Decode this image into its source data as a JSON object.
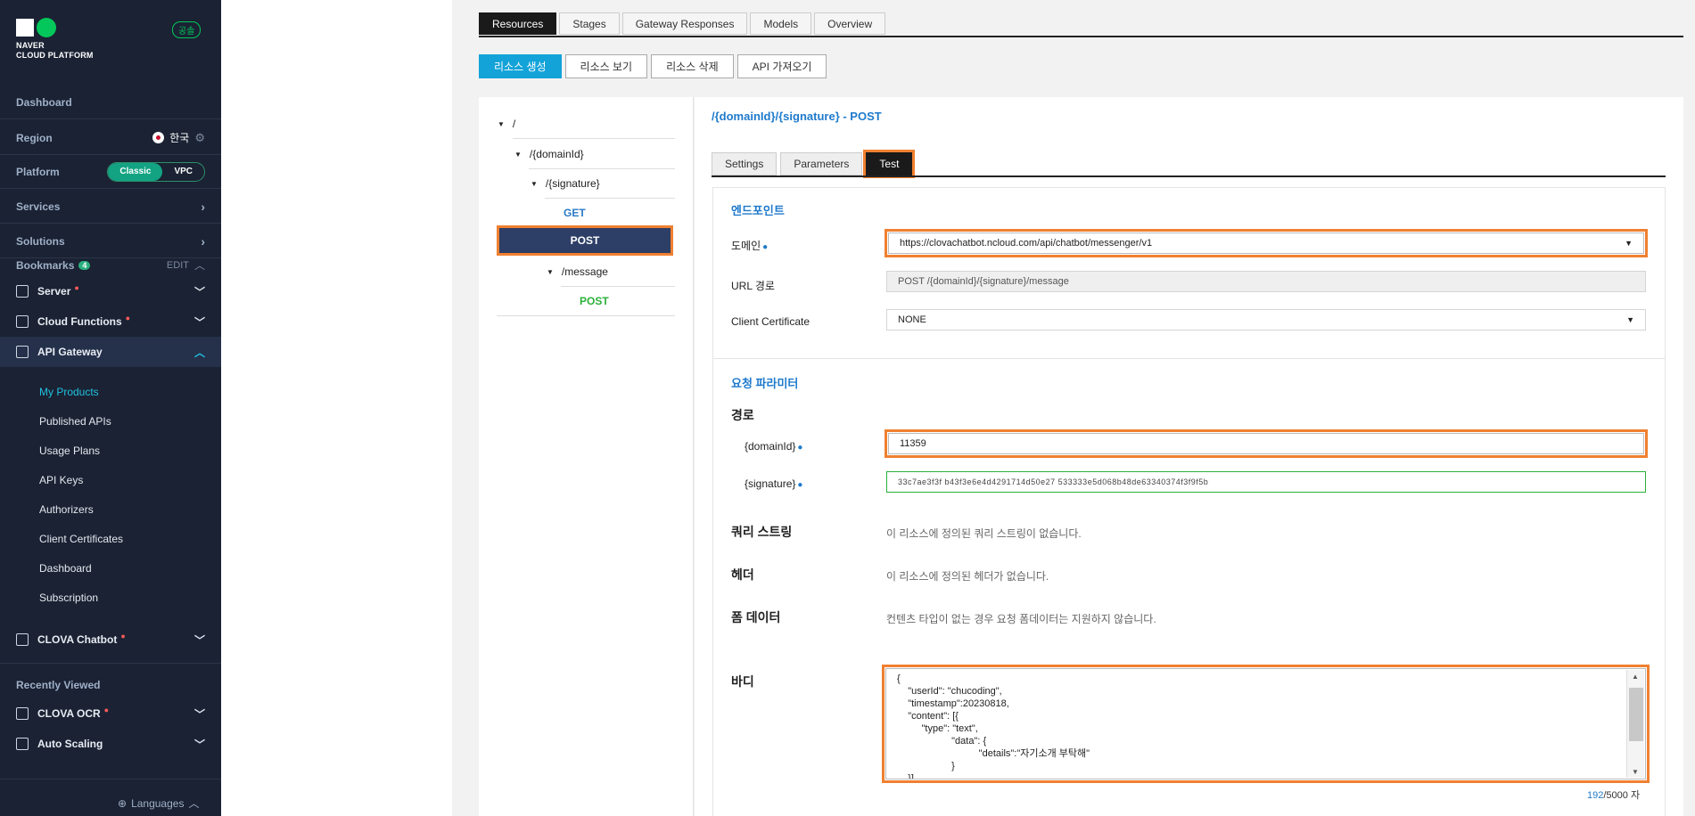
{
  "sidebar": {
    "logo_text_1": "NAVER",
    "logo_text_2": "CLOUD PLATFORM",
    "gov_badge": "공솔",
    "dashboard": "Dashboard",
    "region_label": "Region",
    "region_value": "한국",
    "platform_label": "Platform",
    "platform_options": [
      "Classic",
      "VPC"
    ],
    "services": "Services",
    "solutions": "Solutions",
    "bookmarks_label": "Bookmarks",
    "bookmarks_count": "4",
    "bookmarks_edit": "EDIT",
    "items": [
      {
        "label": "Server"
      },
      {
        "label": "Cloud Functions"
      },
      {
        "label": "API Gateway"
      },
      {
        "label": "CLOVA Chatbot"
      }
    ],
    "api_gateway_sub": [
      "My Products",
      "Published APIs",
      "Usage Plans",
      "API Keys",
      "Authorizers",
      "Client Certificates",
      "Dashboard",
      "Subscription"
    ],
    "recently_viewed": "Recently Viewed",
    "recent_items": [
      {
        "label": "CLOVA OCR"
      },
      {
        "label": "Auto Scaling"
      }
    ],
    "languages": "Languages"
  },
  "tabs": [
    "Resources",
    "Stages",
    "Gateway Responses",
    "Models",
    "Overview"
  ],
  "actions": [
    "리소스 생성",
    "리소스 보기",
    "리소스 삭제",
    "API 가져오기"
  ],
  "tree": {
    "root": "/",
    "domain": "/{domainId}",
    "signature": "/{signature}",
    "get": "GET",
    "post": "POST",
    "message": "/message",
    "post2": "POST"
  },
  "detail": {
    "title": "/{domainId}/{signature} - POST",
    "subtabs": [
      "Settings",
      "Parameters",
      "Test"
    ],
    "endpoint_title": "엔드포인트",
    "domain_label": "도메인",
    "domain_value": "https://clovachatbot.ncloud.com/api/chatbot/messenger/v1",
    "url_label": "URL 경로",
    "url_value": "POST /{domainId}/{signature}/message",
    "cert_label": "Client Certificate",
    "cert_value": "NONE",
    "params_title": "요청 파라미터",
    "path_label": "경로",
    "domainid_label": "{domainId}",
    "domainid_value": "11359",
    "signature_label": "{signature}",
    "signature_value": "33c7ae3f3f b43f3e6e4d4291714d50e27 533333e5d068b48de63340374f3f9f5b",
    "query_label": "쿼리 스트링",
    "query_note": "이 리소스에 정의된 쿼리 스트링이 없습니다.",
    "header_label": "헤더",
    "header_note": "이 리소스에 정의된 헤더가 없습니다.",
    "form_label": "폼 데이터",
    "form_note": "컨텐츠 타입이 없는 경우 요청 폼데이터는 지원하지 않습니다.",
    "body_label": "바디",
    "body_value": "{\n    \"userId\": \"chucoding\",\n    \"timestamp\":20230818,\n    \"content\": [{\n         \"type\": \"text\",\n                    \"data\": {\n                              \"details\":\"자기소개 부탁해\"\n                    }\n    }]",
    "counter_num": "192",
    "counter_rest": "/5000 자"
  },
  "colors": {
    "accent": "#1f7acc",
    "highlight": "#f08030",
    "sidebar_bg": "#1a2233",
    "primary_btn": "#13a3d9"
  }
}
